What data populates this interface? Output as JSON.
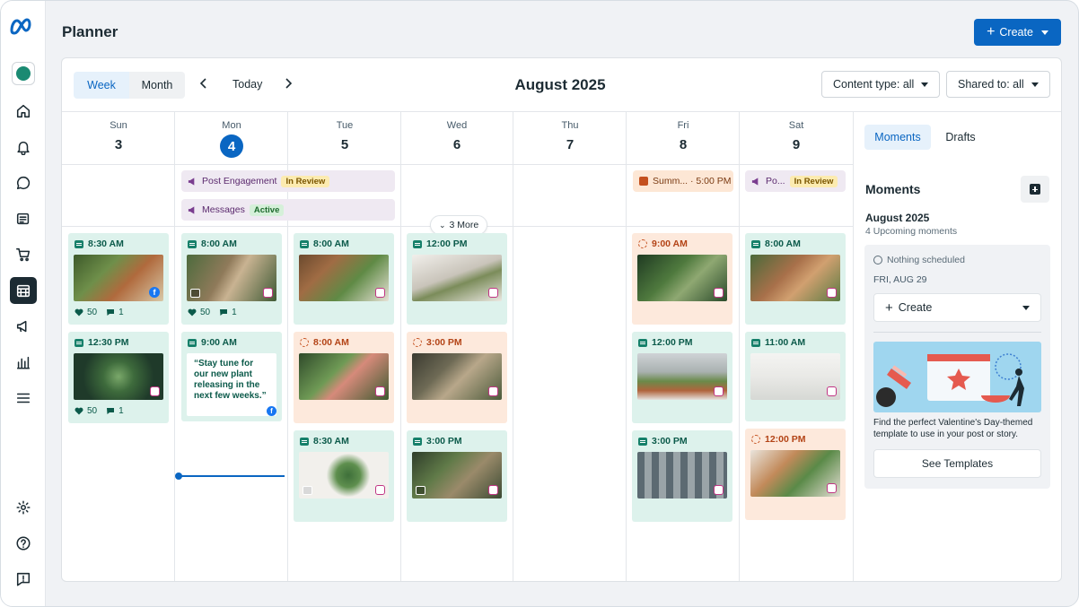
{
  "app": {
    "title": "Planner"
  },
  "header": {
    "create_label": "Create"
  },
  "toolbar": {
    "week_label": "Week",
    "month_label": "Month",
    "today_label": "Today",
    "month_title": "August 2025",
    "content_type_label": "Content type: all",
    "shared_to_label": "Shared to: all"
  },
  "days": [
    {
      "name": "Sun",
      "num": "3"
    },
    {
      "name": "Mon",
      "num": "4"
    },
    {
      "name": "Tue",
      "num": "5"
    },
    {
      "name": "Wed",
      "num": "6"
    },
    {
      "name": "Thu",
      "num": "7"
    },
    {
      "name": "Fri",
      "num": "8"
    },
    {
      "name": "Sat",
      "num": "9"
    }
  ],
  "banners": {
    "post_engagement": {
      "label": "Post Engagement",
      "badge": "In Review"
    },
    "messages": {
      "label": "Messages",
      "badge": "Active"
    },
    "summer": {
      "label": "Summ... · 5:00 PM"
    },
    "sat": {
      "label": "Po...",
      "badge": "In Review"
    }
  },
  "more_label": "3 More",
  "posts": {
    "sun1": {
      "time": "8:30 AM",
      "likes": "50",
      "comments": "1"
    },
    "sun2": {
      "time": "12:30 PM",
      "likes": "50",
      "comments": "1"
    },
    "mon1": {
      "time": "8:00 AM",
      "likes": "50",
      "comments": "1"
    },
    "mon2": {
      "time": "9:00 AM",
      "quote": "“Stay tune for our new plant releasing in the next few weeks.”"
    },
    "tue1": {
      "time": "8:00 AM"
    },
    "tue2": {
      "time": "8:00 AM"
    },
    "tue3": {
      "time": "8:30 AM"
    },
    "wed1": {
      "time": "12:00 PM"
    },
    "wed2": {
      "time": "3:00 PM"
    },
    "wed3": {
      "time": "3:00 PM"
    },
    "fri1": {
      "time": "9:00 AM"
    },
    "fri2": {
      "time": "12:00 PM"
    },
    "fri3": {
      "time": "3:00 PM"
    },
    "sat1": {
      "time": "8:00 AM"
    },
    "sat2": {
      "time": "11:00 AM"
    },
    "sat3": {
      "time": "12:00 PM"
    }
  },
  "right_panel": {
    "tab_moments": "Moments",
    "tab_drafts": "Drafts",
    "title": "Moments",
    "month": "August 2025",
    "upcoming": "4 Upcoming moments",
    "nothing": "Nothing scheduled",
    "date": "FRI, AUG 29",
    "create_label": "Create",
    "description": "Find the perfect Valentine's Day-themed template to use in your post or story.",
    "see_templates": "See Templates"
  },
  "colors": {
    "accent": "#0a66c2",
    "scheduled": "#ddf2ec",
    "draft": "#fde9dc"
  }
}
